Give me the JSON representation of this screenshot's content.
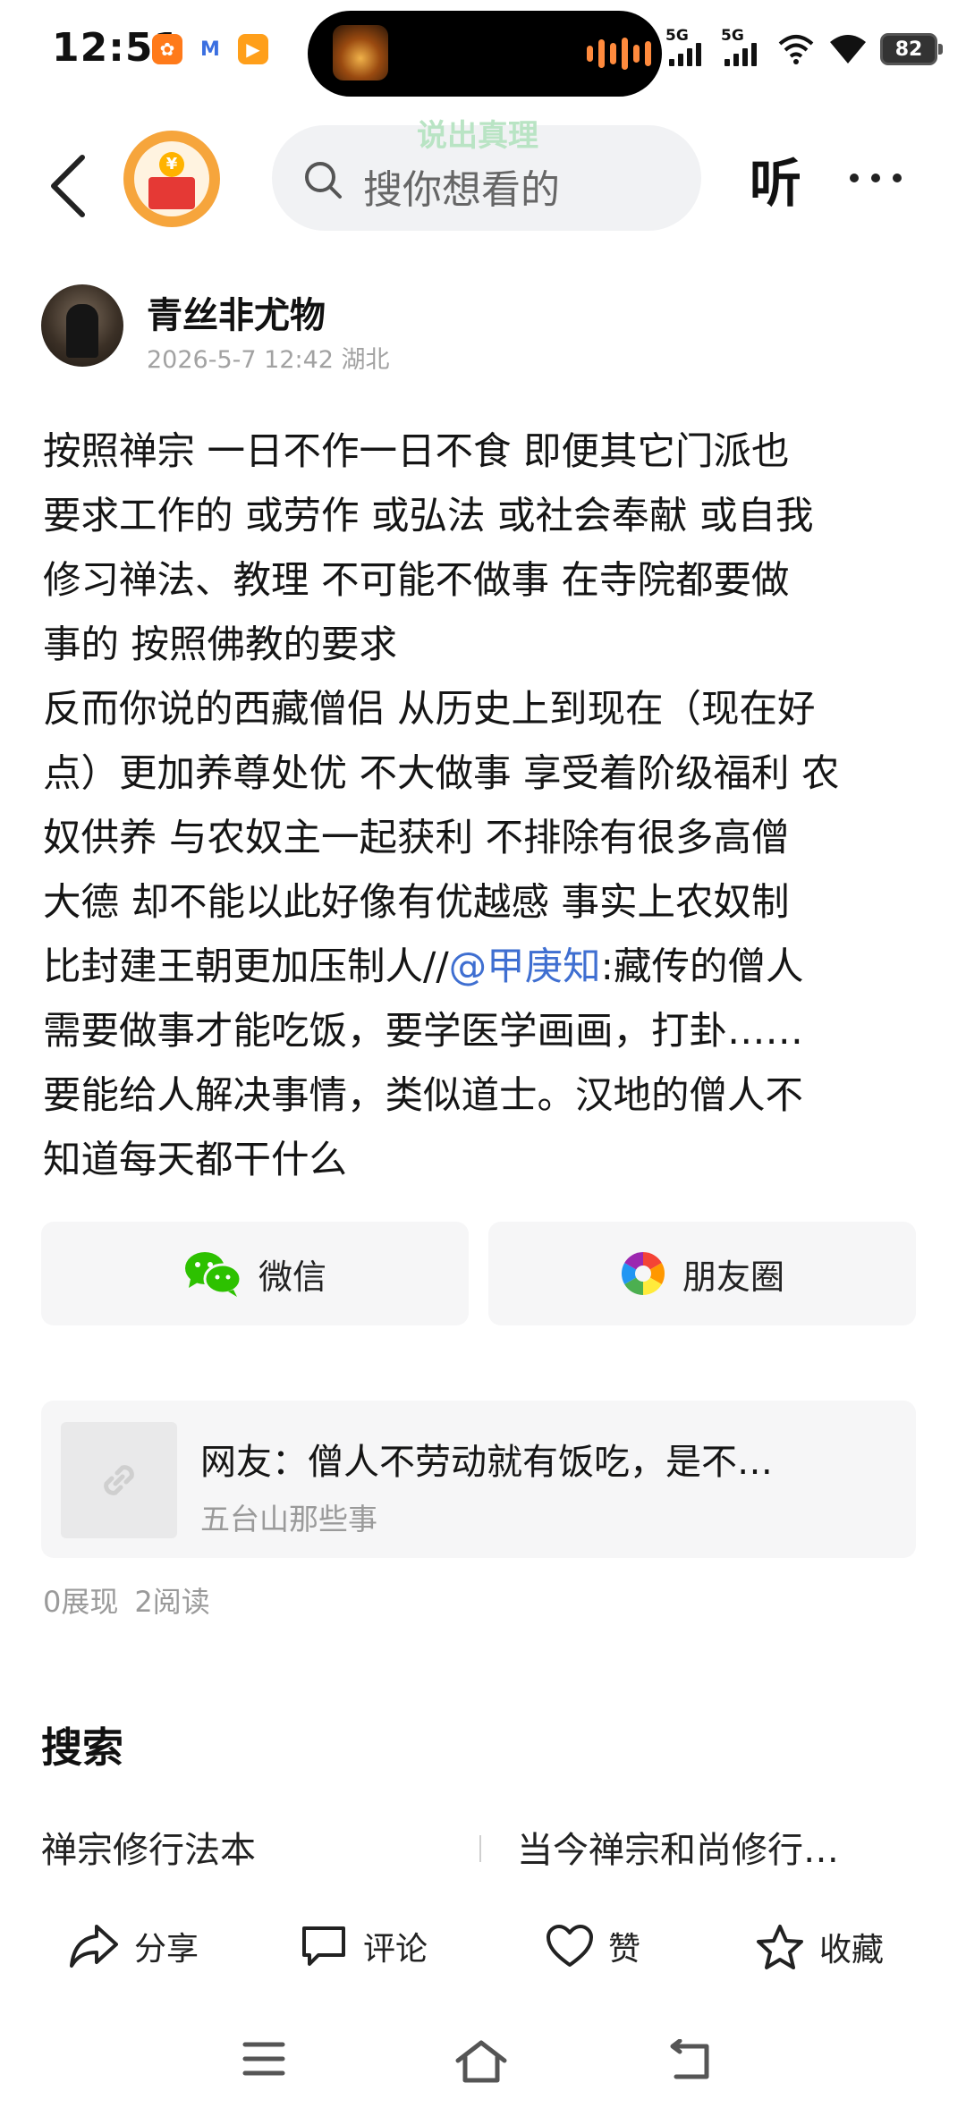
{
  "status_bar": {
    "time": "12:51",
    "app_icons": [
      "orange-app-icon",
      "mail-app-icon",
      "video-app-icon"
    ],
    "signal_1": "5G",
    "signal_2": "5G",
    "battery": "82"
  },
  "header": {
    "hint_text": "说出真理",
    "search_placeholder": "搜你想看的",
    "listen_label": "听"
  },
  "author": {
    "name": "青丝非尤物",
    "meta": "2026-5-7 12:42 湖北"
  },
  "post": {
    "lines": [
      "按照禅宗 一日不作一日不食 即便其它门派也",
      "要求工作的 或劳作 或弘法 或社会奉献 或自我",
      "修习禅法、教理 不可能不做事 在寺院都要做",
      "事的 按照佛教的要求",
      "反而你说的西藏僧侣 从历史上到现在（现在好",
      "点）更加养尊处优 不大做事 享受着阶级福利 农",
      "奴供养 与农奴主一起获利 不排除有很多高僧",
      "大德 却不能以此好像有优越感 事实上农奴制"
    ],
    "line9_before": "比封建王朝更加压制人//",
    "line9_mention": "@甲庚知",
    "line9_after": ":藏传的僧人",
    "lines_tail": [
      "需要做事才能吃饭，要学医学画画，打卦……",
      "要能给人解决事情，类似道士。汉地的僧人不",
      "知道每天都干什么"
    ]
  },
  "share": {
    "wechat_label": "微信",
    "moments_label": "朋友圈"
  },
  "link_card": {
    "title": "网友：僧人不劳动就有饭吃，是不…",
    "source": "五台山那些事"
  },
  "stats": {
    "impressions": "0展现",
    "reads": "2阅读"
  },
  "search_section": {
    "title": "搜索",
    "suggestions": [
      "禅宗修行法本",
      "当今禅宗和尚修行…"
    ]
  },
  "actions": {
    "share": "分享",
    "comment": "评论",
    "like": "赞",
    "collect": "收藏"
  },
  "colors": {
    "mention": "#3f6fd1",
    "wechat_green": "#2dc100",
    "tile_bg": "#f6f6f7",
    "logo_orange": "#f6a53c"
  }
}
